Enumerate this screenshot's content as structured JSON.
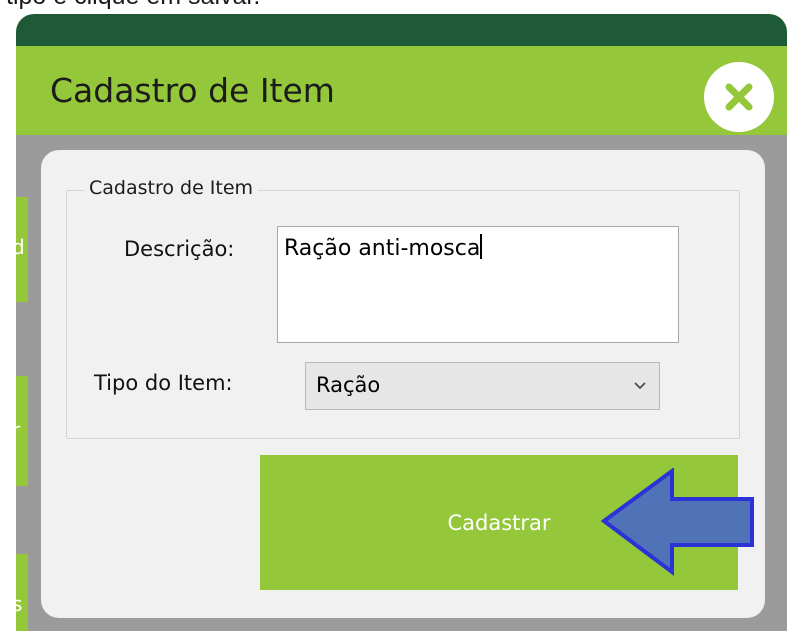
{
  "caption": "tipo e clique em salvar.",
  "window": {
    "title": "Cadastro de Item"
  },
  "background_glyphs": [
    "d",
    "r",
    "s"
  ],
  "form": {
    "group_title": "Cadastro de Item",
    "description_label": "Descrição:",
    "description_value": "Ração anti-mosca",
    "type_label": "Tipo do Item:",
    "type_selected": "Ração",
    "submit_label": "Cadastrar"
  },
  "colors": {
    "titlebar_green": "#94c83a",
    "dark_green": "#1d5a35",
    "button_green": "#94c83a",
    "close_icon": "#94c83a",
    "arrow_fill": "#5072b7",
    "arrow_stroke": "#2b33d6",
    "window_gray": "#9b9b9b",
    "panel": "#f1f1f1"
  },
  "icons": {
    "close": "close-x-icon",
    "dropdown": "chevron-down-icon",
    "pointer": "left-arrow-annotation"
  }
}
